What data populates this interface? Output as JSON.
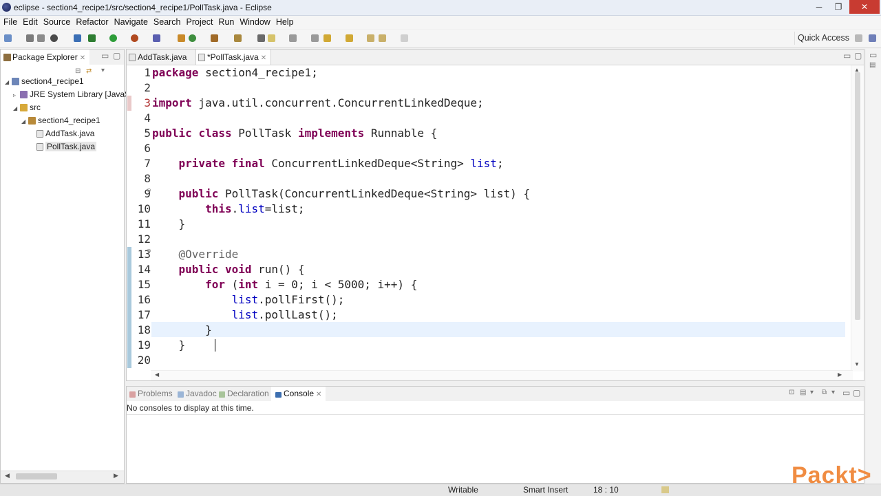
{
  "window": {
    "title": "eclipse - section4_recipe1/src/section4_recipe1/PollTask.java - Eclipse",
    "minimize": "─",
    "maximize": "❐",
    "close": "✕"
  },
  "menu": [
    "File",
    "Edit",
    "Source",
    "Refactor",
    "Navigate",
    "Search",
    "Project",
    "Run",
    "Window",
    "Help"
  ],
  "toolbar": {
    "quick_access": "Quick Access"
  },
  "package_explorer": {
    "tab": "Package Explorer",
    "tree": [
      {
        "label": "section4_recipe1",
        "level": 0,
        "icon": "project-icon"
      },
      {
        "label": "JRE System Library [JavaS",
        "level": 1,
        "icon": "library-icon"
      },
      {
        "label": "src",
        "level": 1,
        "icon": "source-folder-icon"
      },
      {
        "label": "section4_recipe1",
        "level": 2,
        "icon": "package-icon"
      },
      {
        "label": "AddTask.java",
        "level": 3,
        "icon": "java-file-icon"
      },
      {
        "label": "PollTask.java",
        "level": 3,
        "icon": "java-file-icon"
      }
    ]
  },
  "editor": {
    "tabs": [
      {
        "label": "AddTask.java"
      },
      {
        "label": "*PollTask.java"
      }
    ],
    "line_numbers": [
      "1",
      "2",
      "3",
      "4",
      "5",
      "6",
      "7",
      "8",
      "9",
      "10",
      "11",
      "12",
      "13",
      "14",
      "15",
      "16",
      "17",
      "18",
      "19",
      "20"
    ]
  },
  "console": {
    "tabs": [
      "Problems",
      "Javadoc",
      "Declaration",
      "Console"
    ],
    "message": "No consoles to display at this time."
  },
  "statusbar": {
    "writable": "Writable",
    "insert_mode": "Smart Insert",
    "position": "18 : 10"
  },
  "logo": "Packt>",
  "colors": {
    "keyword": "#7f0055",
    "field": "#0000c0",
    "annotation": "#646464",
    "current_line": "#e8f2fe",
    "logo": "#f08c42"
  }
}
